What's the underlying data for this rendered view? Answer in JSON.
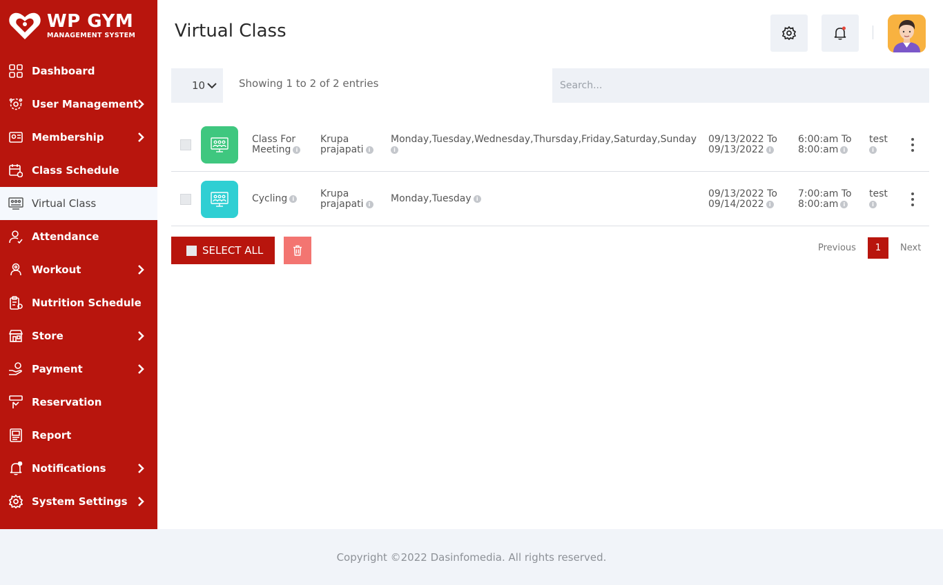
{
  "brand": {
    "title": "WP GYM",
    "subtitle": "MANAGEMENT SYSTEM",
    "color": "#b8150d"
  },
  "sidebar": {
    "items": [
      {
        "label": "Dashboard",
        "icon": "dashboard-grid-icon",
        "chevron": false
      },
      {
        "label": "User Management",
        "icon": "users-gear-icon",
        "chevron": true
      },
      {
        "label": "Membership",
        "icon": "membership-card-icon",
        "chevron": true
      },
      {
        "label": "Class Schedule",
        "icon": "calendar-icon",
        "chevron": false
      },
      {
        "label": "Virtual Class",
        "icon": "virtual-class-icon",
        "chevron": false,
        "active": true
      },
      {
        "label": "Attendance",
        "icon": "attendance-user-icon",
        "chevron": false
      },
      {
        "label": "Workout",
        "icon": "workout-icon",
        "chevron": true
      },
      {
        "label": "Nutrition Schedule",
        "icon": "nutrition-clipboard-icon",
        "chevron": false
      },
      {
        "label": "Store",
        "icon": "store-icon",
        "chevron": true
      },
      {
        "label": "Payment",
        "icon": "payment-hand-icon",
        "chevron": true
      },
      {
        "label": "Reservation",
        "icon": "reservation-icon",
        "chevron": false
      },
      {
        "label": "Report",
        "icon": "report-icon",
        "chevron": false
      },
      {
        "label": "Notifications",
        "icon": "bell-icon",
        "chevron": true
      },
      {
        "label": "System Settings",
        "icon": "gear-icon",
        "chevron": true
      }
    ]
  },
  "header": {
    "title": "Virtual Class"
  },
  "controls": {
    "page_length": "10",
    "showing": "Showing 1 to 2 of 2 entries",
    "search_placeholder": "Search..."
  },
  "rows": [
    {
      "class_line1": "Class For",
      "class_line2": "Meeting",
      "staff_line1": "Krupa",
      "staff_line2": "prajapati",
      "days": "Monday,Tuesday,Wednesday,Thursday,Friday,Saturday,Sunday",
      "date_line1": "09/13/2022 To",
      "date_line2": "09/13/2022",
      "time_line1": "6:00:am To",
      "time_line2": "8:00:am",
      "topic": "test",
      "thumb_color": "#3fc77f"
    },
    {
      "class_line1": "Cycling",
      "class_line2": "",
      "staff_line1": "Krupa",
      "staff_line2": "prajapati",
      "days": "Monday,Tuesday",
      "date_line1": "09/13/2022 To",
      "date_line2": "09/14/2022",
      "time_line1": "7:00:am To",
      "time_line2": "8:00:am",
      "topic": "test",
      "thumb_color": "#2fcfd3"
    }
  ],
  "actions": {
    "select_all": "SELECT ALL"
  },
  "pagination": {
    "previous": "Previous",
    "current": "1",
    "next": "Next"
  },
  "footer": {
    "text": "Copyright ©2022 Dasinfomedia. All rights reserved."
  }
}
